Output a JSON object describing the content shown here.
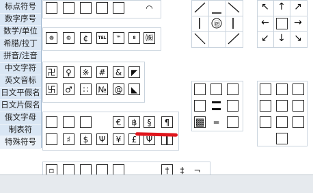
{
  "sidebar": {
    "tabs": [
      {
        "label": "标点符号"
      },
      {
        "label": "数字序号"
      },
      {
        "label": "数学/单位"
      },
      {
        "label": "希腊/拉丁"
      },
      {
        "label": "拼音/注音"
      },
      {
        "label": "中文字符"
      },
      {
        "label": "英文音标"
      },
      {
        "label": "日文平假名"
      },
      {
        "label": "日文片假名"
      },
      {
        "label": "俄文字母"
      },
      {
        "label": "制表符"
      },
      {
        "label": "特殊符号"
      }
    ],
    "active_tab": "特殊符号"
  },
  "symbols": {
    "row_top": [
      "",
      "",
      "",
      "",
      "",
      "◠"
    ],
    "row_abbr": [
      "®",
      "©",
      "¢",
      "TEL",
      "™",
      "8",
      "㈱"
    ],
    "row_mid1": [
      "卍",
      "♀",
      "※",
      "#",
      "&",
      "◤",
      ""
    ],
    "row_mid2": [
      "卐",
      "♂",
      "∷",
      "№",
      "@",
      "◣",
      ""
    ],
    "row_cur1": [
      "",
      "",
      "",
      "€",
      "฿",
      "§",
      "¶"
    ],
    "row_cur2": [
      "",
      "♯",
      "$",
      "Ψ",
      "¥",
      "£",
      "Ψ",
      "‖"
    ],
    "row_bottom": [
      "▫",
      "",
      "",
      "",
      "",
      "†",
      "‡",
      "¬",
      "¬"
    ]
  },
  "arrows": [
    "↖",
    "↑",
    "↗",
    "←",
    "",
    "→",
    "↙",
    "↓",
    "↘"
  ],
  "box_grid": [
    "",
    "",
    "",
    "",
    "",
    "",
    "▩",
    "═",
    ""
  ],
  "box_grid2": [
    "",
    "",
    "",
    "",
    "",
    "",
    "",
    "",
    "",
    ""
  ],
  "center_symbol": "㊣",
  "colors": {
    "highlight": "#e0161d",
    "sidebar_bg": "#d9e6f4",
    "cell_border": "#2c2c2c"
  }
}
